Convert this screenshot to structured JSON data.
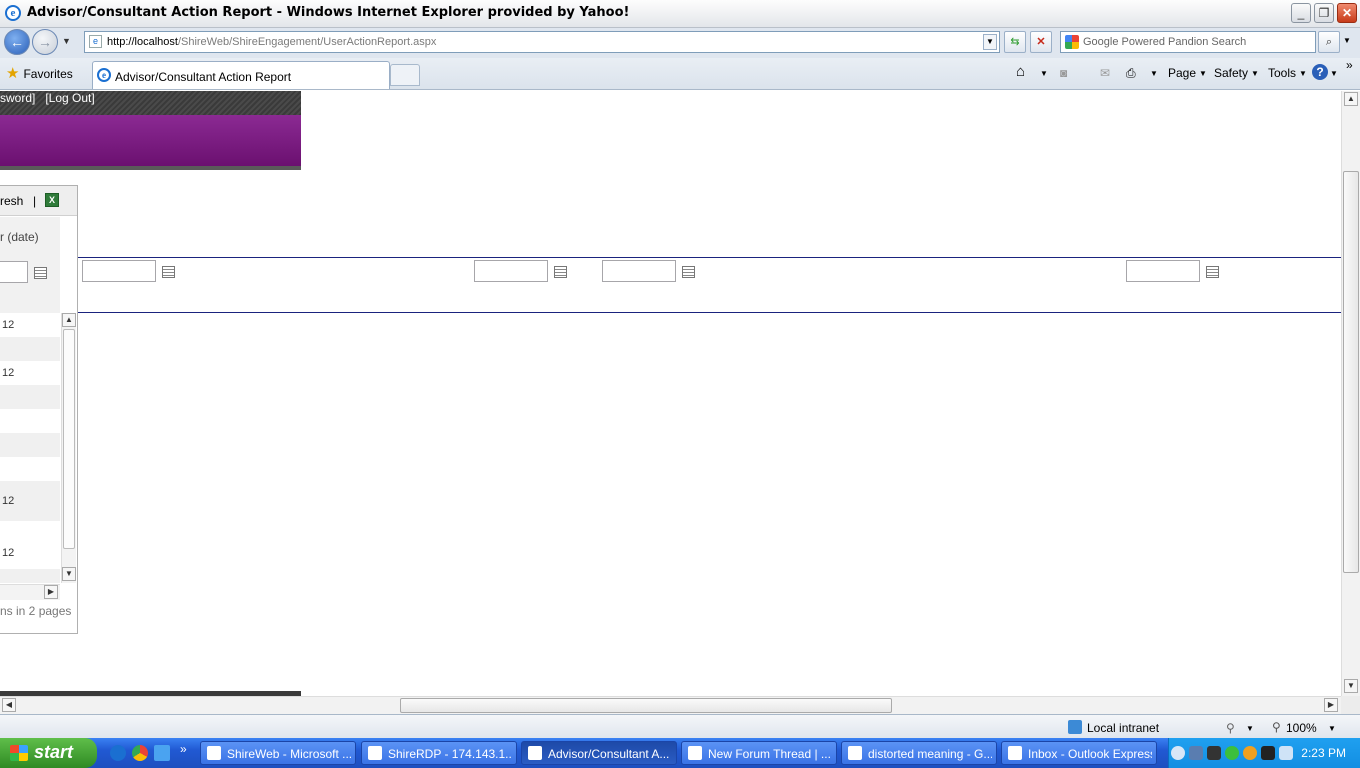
{
  "window": {
    "title": "Advisor/Consultant Action Report - Windows Internet Explorer provided by Yahoo!",
    "buttons": {
      "minimize": "_",
      "restore": "❐",
      "close": "✕"
    }
  },
  "address_bar": {
    "url_host": "http://localhost",
    "url_path": "/ShireWeb/ShireEngagement/UserActionReport.aspx",
    "search_placeholder": "Google Powered Pandion Search"
  },
  "tabs_row": {
    "favorites_label": "Favorites",
    "active_tab_label": "Advisor/Consultant Action Report",
    "commands": [
      "Page",
      "Safety",
      "Tools"
    ]
  },
  "page": {
    "header_links": "sword]   [Log Out]",
    "grid": {
      "toolbar_refresh": "resh",
      "toolbar_separator": "|",
      "column_header": "r (date)",
      "rows": [
        "12",
        "",
        "12",
        "",
        "",
        "",
        "",
        "12",
        "",
        "12",
        "",
        "12"
      ],
      "pager_text": "ns in 2 pages"
    }
  },
  "status_bar": {
    "zone": "Local intranet",
    "zoom": "100%"
  },
  "taskbar": {
    "start_label": "start",
    "tasks": [
      {
        "label": "ShireWeb - Microsoft ...",
        "active": false
      },
      {
        "label": "ShireRDP - 174.143.1...",
        "active": false
      },
      {
        "label": "Advisor/Consultant A...",
        "active": true
      },
      {
        "label": "New Forum Thread | ...",
        "active": false
      },
      {
        "label": "distorted meaning - G...",
        "active": false
      },
      {
        "label": "Inbox - Outlook Express",
        "active": false
      }
    ],
    "clock": "2:23 PM",
    "overflow_chevron": "»"
  },
  "colors": {
    "banner_purple": "#7b1c82",
    "rule_navy": "#1a237e",
    "taskbar_blue": "#2159d3",
    "start_green": "#3a9a2c"
  }
}
